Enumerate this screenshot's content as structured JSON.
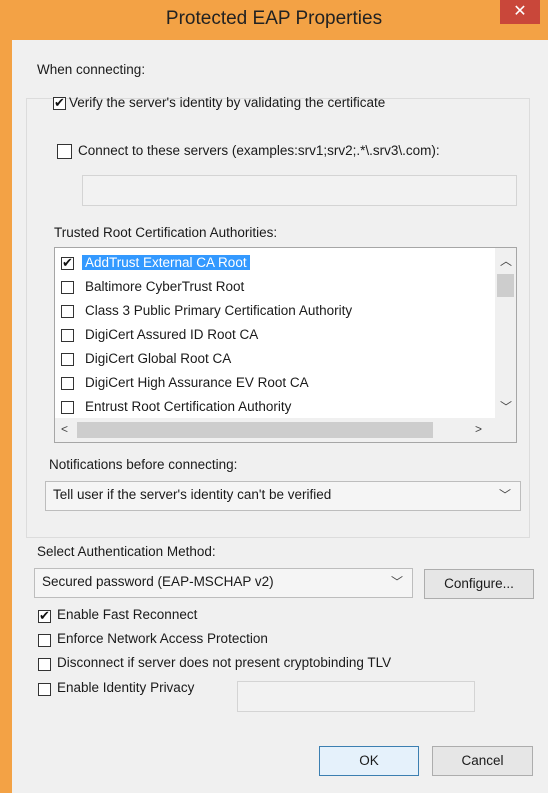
{
  "window": {
    "title": "Protected EAP Properties",
    "close_glyph": "✕"
  },
  "connecting": {
    "heading": "When connecting:",
    "verify_label": "Verify the server's identity by validating the certificate",
    "verify_checked": true,
    "connect_servers_label": "Connect to these servers (examples:srv1;srv2;.*\\.srv3\\.com):",
    "connect_servers_checked": false,
    "servers_value": ""
  },
  "trusted_root": {
    "heading": "Trusted Root Certification Authorities:",
    "items": [
      {
        "label": "AddTrust External CA Root",
        "checked": true,
        "selected": true
      },
      {
        "label": "Baltimore CyberTrust Root",
        "checked": false,
        "selected": false
      },
      {
        "label": "Class 3 Public Primary Certification Authority",
        "checked": false,
        "selected": false
      },
      {
        "label": "DigiCert Assured ID Root CA",
        "checked": false,
        "selected": false
      },
      {
        "label": "DigiCert Global Root CA",
        "checked": false,
        "selected": false
      },
      {
        "label": "DigiCert High Assurance EV Root CA",
        "checked": false,
        "selected": false
      },
      {
        "label": "Entrust Root Certification Authority",
        "checked": false,
        "selected": false
      }
    ]
  },
  "notifications": {
    "heading": "Notifications before connecting:",
    "selected": "Tell user if the server's identity can't be verified"
  },
  "auth": {
    "heading": "Select Authentication Method:",
    "selected": "Secured password (EAP-MSCHAP v2)",
    "configure_label": "Configure..."
  },
  "options": {
    "fast_reconnect": {
      "label": "Enable Fast Reconnect",
      "checked": true
    },
    "nap": {
      "label": "Enforce Network Access Protection",
      "checked": false
    },
    "cryptobinding": {
      "label": "Disconnect if server does not present cryptobinding TLV",
      "checked": false
    },
    "identity_privacy": {
      "label": "Enable Identity Privacy",
      "checked": false,
      "value": ""
    }
  },
  "buttons": {
    "ok": "OK",
    "cancel": "Cancel"
  }
}
